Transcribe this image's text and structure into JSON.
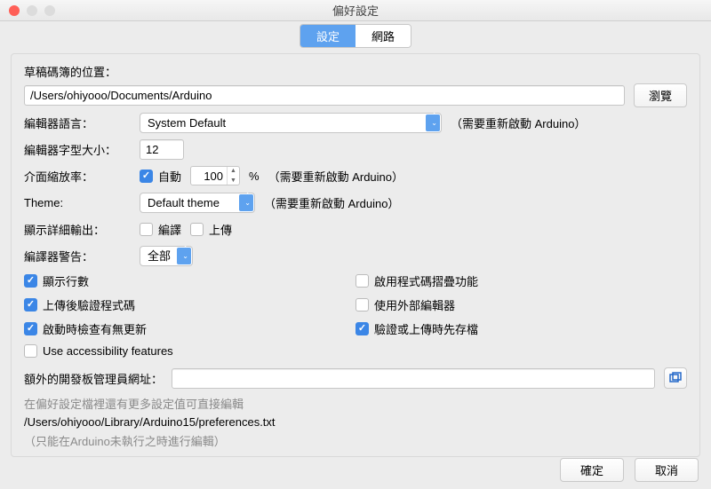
{
  "window": {
    "title": "偏好設定"
  },
  "tabs": {
    "settings": "設定",
    "network": "網路"
  },
  "labels": {
    "sketchbook": "草稿碼簿的位置：",
    "browse": "瀏覽",
    "editor_lang": "編輯器語言：",
    "restart_note": "（需要重新啟動 Arduino）",
    "font_size": "編輯器字型大小：",
    "scale": "介面縮放率：",
    "auto": "自動",
    "percent": "%",
    "theme": "Theme:",
    "verbose": "顯示詳細輸出：",
    "compile": "編譯",
    "upload": "上傳",
    "warnings": "編譯器警告：",
    "board_urls": "額外的開發板管理員網址：",
    "more_prefs1": "在偏好設定檔裡還有更多設定值可直接編輯",
    "more_prefs2": "（只能在Arduino未執行之時進行編輯）"
  },
  "values": {
    "sketchbook_path": "/Users/ohiyooo/Documents/Arduino",
    "language": "System Default",
    "font_size": "12",
    "scale": "100",
    "theme": "Default theme",
    "warnings": "全部",
    "board_urls": "",
    "prefs_path": "/Users/ohiyooo/Library/Arduino15/preferences.txt"
  },
  "checkboxes": {
    "auto_scale": true,
    "compile_verbose": false,
    "upload_verbose": false,
    "show_lines": {
      "checked": true,
      "label": "顯示行數"
    },
    "verify_upload": {
      "checked": true,
      "label": "上傳後驗證程式碼"
    },
    "check_updates": {
      "checked": true,
      "label": "啟動時檢查有無更新"
    },
    "accessibility": {
      "checked": false,
      "label": "Use accessibility features"
    },
    "code_folding": {
      "checked": false,
      "label": "啟用程式碼摺疊功能"
    },
    "external_editor": {
      "checked": false,
      "label": "使用外部編輯器"
    },
    "save_verify": {
      "checked": true,
      "label": "驗證或上傳時先存檔"
    }
  },
  "footer": {
    "ok": "確定",
    "cancel": "取消"
  }
}
